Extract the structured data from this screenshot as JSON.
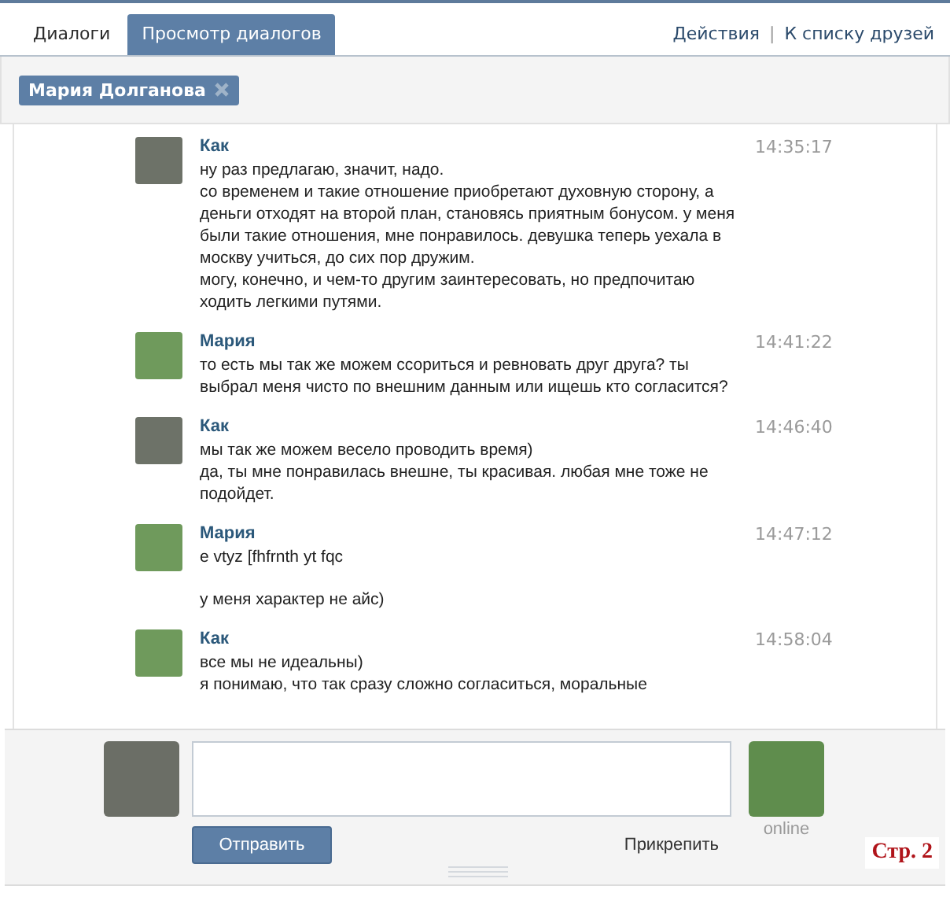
{
  "tabs": [
    {
      "label": "Диалоги",
      "selected": false
    },
    {
      "label": "Просмотр диалогов",
      "selected": true
    }
  ],
  "header_links": [
    "Действия",
    "|",
    "К списку друзей"
  ],
  "filter_tag": {
    "label": "Мария Долганова"
  },
  "messages": [
    {
      "kind": "message",
      "sender": "Как",
      "time": "14:35:17",
      "paragraphs": [
        "ну раз предлагаю, значит, надо.",
        "со временем и такие отношение приобретают духовную сторону, а деньги отходят на второй план, становясь приятным бонусом. у меня были такие отношения, мне понравилось. девушка теперь уехала в москву учиться, до сих пор дружим.",
        "могу, конечно, и чем-то другим заинтересовать, но предпочитаю ходить легкими путями."
      ]
    },
    {
      "kind": "message",
      "sender": "Мария",
      "time": "14:41:22",
      "paragraphs": [
        "то есть мы так же можем ссориться и ревновать друг друга? ты выбрал меня чисто по внешним данным или ищешь кто согласится?"
      ]
    },
    {
      "kind": "message",
      "sender": "Как",
      "time": "14:46:40",
      "paragraphs": [
        "мы так же можем весело проводить время)",
        "да, ты мне понравилась внешне, ты красивая. любая мне тоже не подойдет."
      ]
    },
    {
      "kind": "message",
      "sender": "Мария",
      "time": "14:47:12",
      "paragraphs": [
        "e vtyz [fhfrnth yt fqc"
      ]
    },
    {
      "kind": "continuation",
      "paragraphs": [
        "у меня характер не айс)"
      ]
    },
    {
      "kind": "message",
      "sender": "Как",
      "time": "14:58:04",
      "paragraphs": [
        "все мы не идеальны)",
        "я понимаю, что так сразу сложно согласиться, моральные"
      ]
    }
  ],
  "composer": {
    "send_button": "Отправить",
    "attach_link": "Прикрепить",
    "status": "online"
  },
  "page_label": "Стр. 2"
}
